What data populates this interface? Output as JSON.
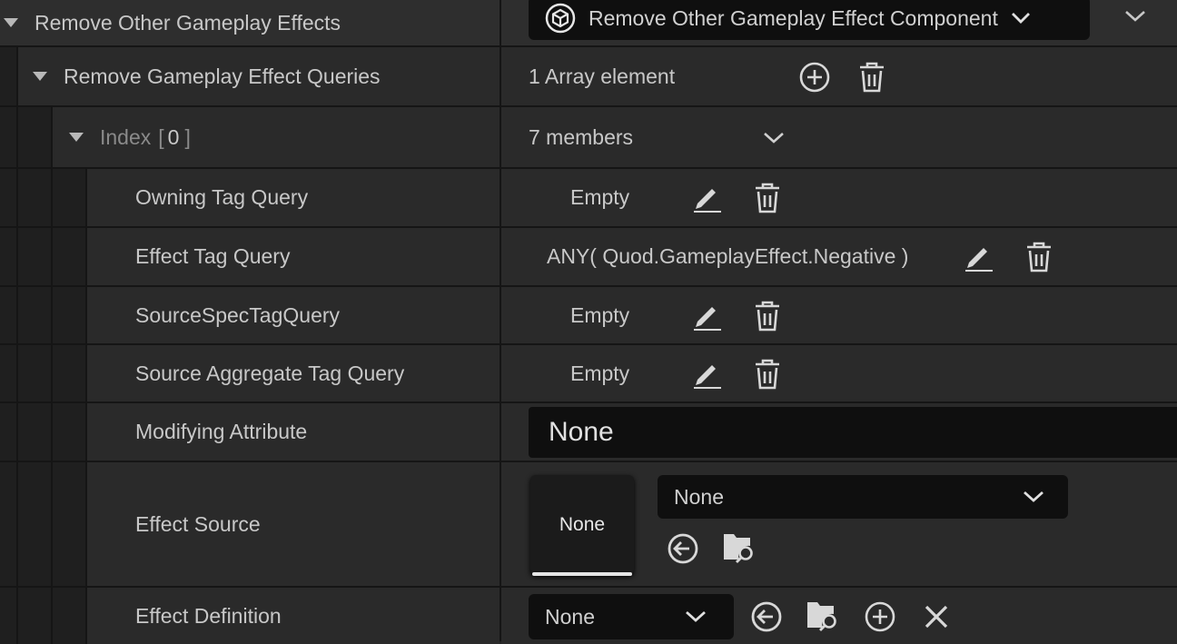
{
  "section": {
    "title": "Remove Other Gameplay Effects",
    "component_label": "Remove Other Gameplay Effect Component"
  },
  "queries": {
    "title": "Remove Gameplay Effect Queries",
    "summary": "1 Array element"
  },
  "index": {
    "label": "Index",
    "open_bracket": "[",
    "value": "0",
    "close_bracket": "]",
    "summary": "7 members"
  },
  "properties": {
    "owning_tag_query": {
      "label": "Owning Tag Query",
      "value": "Empty"
    },
    "effect_tag_query": {
      "label": "Effect Tag Query",
      "value": "ANY( Quod.GameplayEffect.Negative )"
    },
    "source_spec_tag_query": {
      "label": "SourceSpecTagQuery",
      "value": "Empty"
    },
    "source_aggregate_tag_query": {
      "label": "Source Aggregate Tag Query",
      "value": "Empty"
    },
    "modifying_attribute": {
      "label": "Modifying Attribute",
      "value": "None"
    },
    "effect_source": {
      "label": "Effect Source",
      "thumbnail": "None",
      "selected": "None"
    },
    "effect_definition": {
      "label": "Effect Definition",
      "selected": "None"
    }
  },
  "colors": {
    "background": "#242424",
    "row": "#2a2a2a",
    "field": "#0f0f0f",
    "text": "#c8c8c8"
  }
}
